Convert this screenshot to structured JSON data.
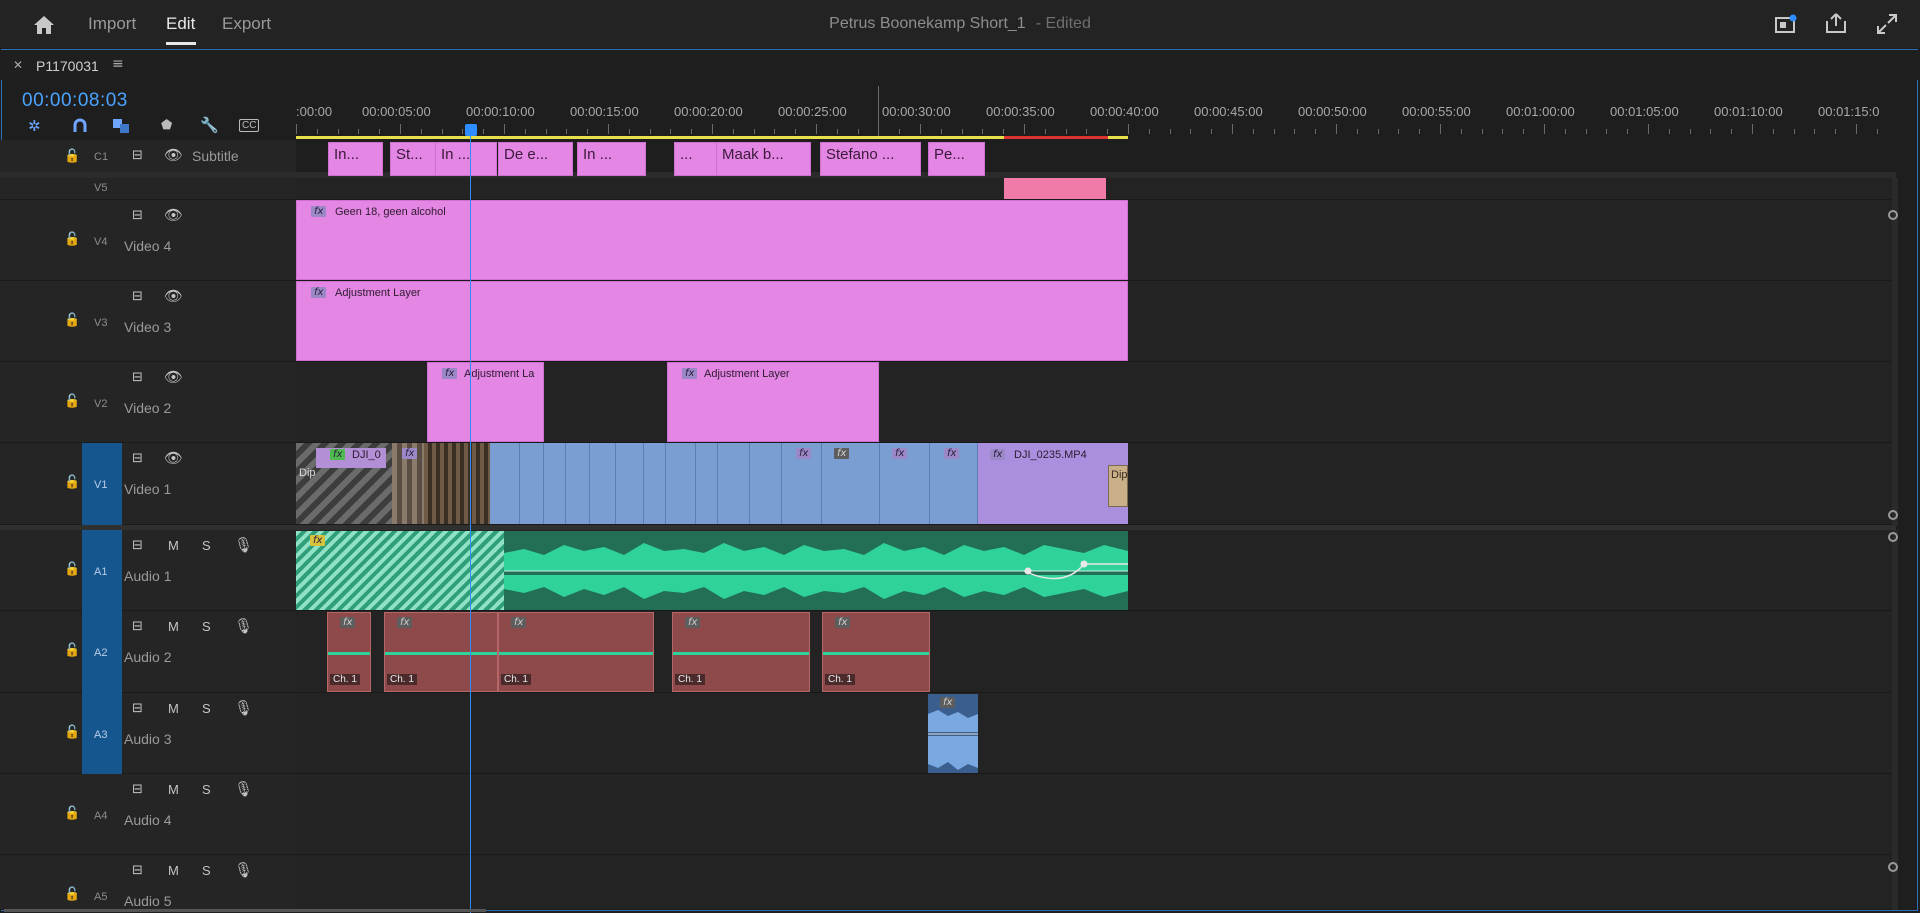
{
  "nav": {
    "home": "home-icon",
    "import": "Import",
    "edit": "Edit",
    "export": "Export"
  },
  "title": {
    "name": "Petrus Boonekamp Short_1",
    "status": "- Edited"
  },
  "panel": {
    "sequence_tab": "P1170031",
    "timecode": "00:00:08:03"
  },
  "ruler": {
    "labels": [
      ":00:00",
      "00:00:05:00",
      "00:00:10:00",
      "00:00:15:00",
      "00:00:20:00",
      "00:00:25:00",
      "00:00:30:00",
      "00:00:35:00",
      "00:00:40:00",
      "00:00:45:00",
      "00:00:50:00",
      "00:00:55:00",
      "00:01:00:00",
      "00:01:05:00",
      "00:01:10:00",
      "00:01:15:0"
    ]
  },
  "tracks": {
    "c1": {
      "target": "C1",
      "name": "Subtitle"
    },
    "v5": {
      "target": "V5"
    },
    "v4": {
      "target": "V4",
      "name": "Video 4"
    },
    "v3": {
      "target": "V3",
      "name": "Video 3"
    },
    "v2": {
      "target": "V2",
      "name": "Video 2"
    },
    "v1": {
      "target": "V1",
      "name": "Video 1"
    },
    "a1": {
      "target": "A1",
      "name": "Audio 1"
    },
    "a2": {
      "target": "A2",
      "name": "Audio 2"
    },
    "a3": {
      "target": "A3",
      "name": "Audio 3"
    },
    "a4": {
      "target": "A4",
      "name": "Audio 4"
    },
    "a5": {
      "target": "A5",
      "name": "Audio 5"
    }
  },
  "track_buttons": {
    "mute": "M",
    "solo": "S"
  },
  "subtitles": [
    "In...",
    "St...",
    "In ...",
    "De e...",
    "In ...",
    "...",
    "Maak b...",
    "Stefano ...",
    "Pe..."
  ],
  "clips": {
    "v4": "Geen 18, geen alcohol",
    "v3": "Adjustment Layer",
    "v2a": "Adjustment La",
    "v2b": "Adjustment Layer",
    "v1a": "DJI_0",
    "v1b": "DJI_0235.MP4",
    "v1c": "Dip",
    "v1d": "Dip"
  },
  "audio_channel_label": "Ch. 1",
  "fx_label": "fx",
  "colors": {
    "accent": "#2d8cff",
    "clip_pink": "#e486e4",
    "clip_blue": "#7a9ed1",
    "audio_green": "#2ecf93",
    "audio_red": "#8e4a4a"
  }
}
